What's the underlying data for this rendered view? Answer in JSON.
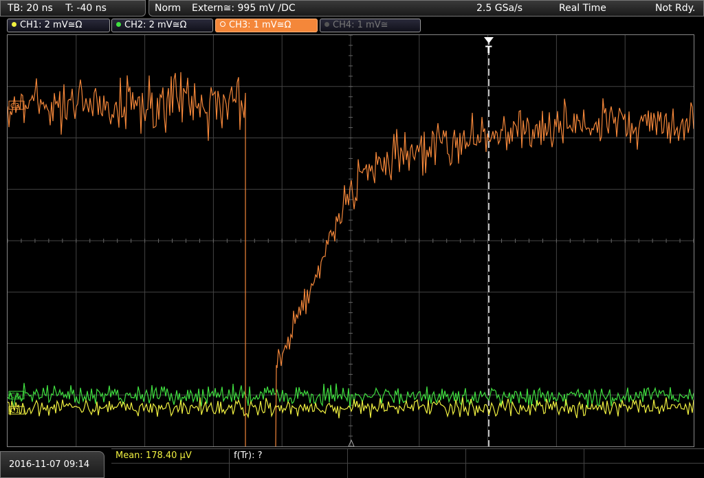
{
  "header": {
    "timebase": "TB: 20 ns",
    "trigger_offset": "T: -40 ns",
    "mode": "Norm",
    "trigger_source": "Extern≅: 995 mV ∕DC",
    "sample_rate": "2.5 GSa/s",
    "acq_mode": "Real Time",
    "status": "Not Rdy."
  },
  "channels": [
    {
      "label": "CH1: 2 mV≅Ω",
      "color": "#f0f040",
      "state": "on"
    },
    {
      "label": "CH2: 2 mV≅Ω",
      "color": "#40e040",
      "state": "on"
    },
    {
      "label": "CH3: 1 mV≅Ω",
      "color": "#f4873a",
      "state": "active"
    },
    {
      "label": "CH4: 1 mV≅",
      "color": "#777777",
      "state": "off"
    }
  ],
  "markers": {
    "c3": "C3",
    "c2": "C2",
    "c1": "C1",
    "trigger": "T"
  },
  "colors": {
    "ch1": "#f0f040",
    "ch2": "#40e040",
    "ch3": "#f4873a",
    "grid": "#444444"
  },
  "footer": {
    "datetime": "2016-11-07 09:14",
    "measurement_1": "Mean: 178.40 µV",
    "measurement_2": "f(Tr): ?"
  }
}
